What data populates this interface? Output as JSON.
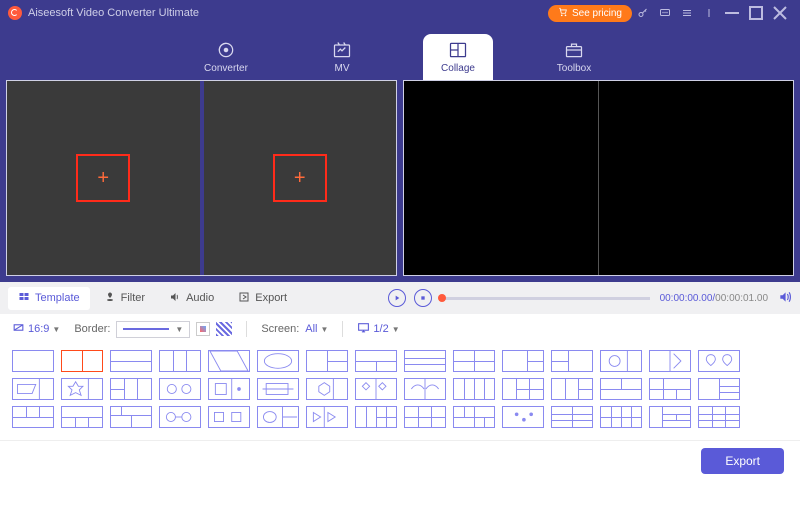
{
  "titlebar": {
    "app_name": "Aiseesoft Video Converter Ultimate",
    "see_pricing": "See pricing"
  },
  "nav": {
    "converter": "Converter",
    "mv": "MV",
    "collage": "Collage",
    "toolbox": "Toolbox"
  },
  "tabs": {
    "template": "Template",
    "filter": "Filter",
    "audio": "Audio",
    "export": "Export"
  },
  "playback": {
    "current": "00:00:00.00",
    "sep": "/",
    "total": "00:00:01.00"
  },
  "options": {
    "ratio": "16:9",
    "border_label": "Border:",
    "screen_label": "Screen:",
    "screen_value": "All",
    "page": "1/2"
  },
  "footer": {
    "export": "Export"
  }
}
